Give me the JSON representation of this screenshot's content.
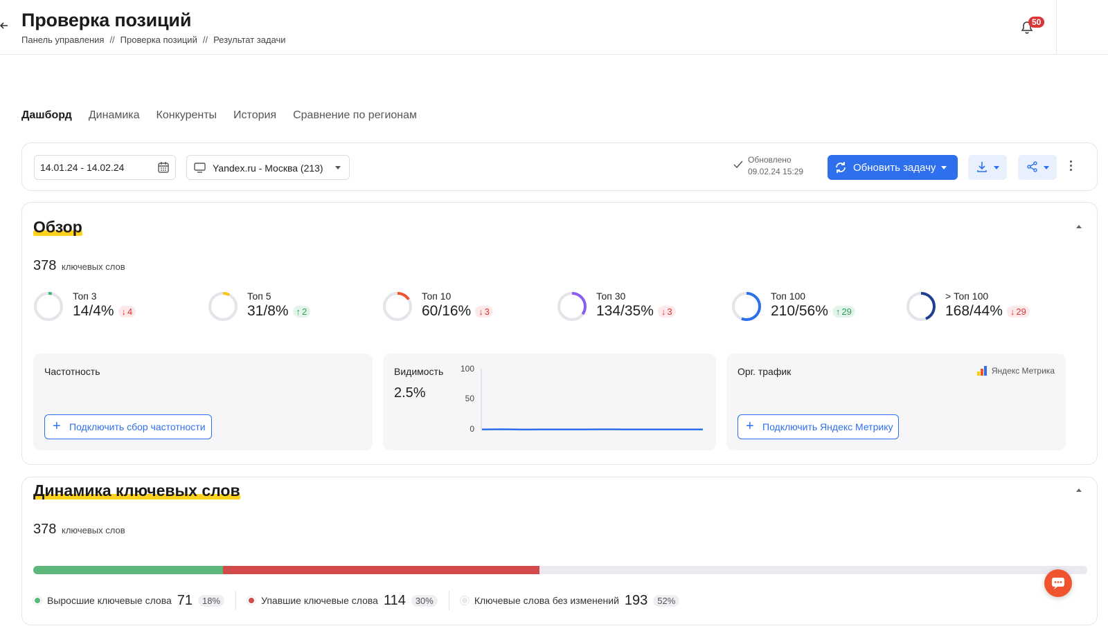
{
  "header": {
    "title": "Проверка позиций",
    "breadcrumb": [
      "Панель управления",
      "Проверка позиций",
      "Результат задачи"
    ],
    "breadcrumb_separator": "//",
    "notifications_count": "50"
  },
  "tabs": [
    {
      "label": "Дашборд",
      "active": true
    },
    {
      "label": "Динамика",
      "active": false
    },
    {
      "label": "Конкуренты",
      "active": false
    },
    {
      "label": "История",
      "active": false
    },
    {
      "label": "Сравнение по регионам",
      "active": false
    }
  ],
  "toolbar": {
    "date_range": "14.01.24 - 14.02.24",
    "region": "Yandex.ru - Москва (213)",
    "updated_label": "Обновлено",
    "updated_at": "09.02.24 15:29",
    "refresh_label": "Обновить задачу"
  },
  "overview": {
    "title": "Обзор",
    "keywords_count": "378",
    "keywords_label": "ключевых слов",
    "tops": [
      {
        "label": "Топ 3",
        "value": "14/4%",
        "percent": 4,
        "delta": "4",
        "direction": "down",
        "color": "#3cb371"
      },
      {
        "label": "Топ 5",
        "value": "31/8%",
        "percent": 8,
        "delta": "2",
        "direction": "up",
        "color": "#f5c518"
      },
      {
        "label": "Топ 10",
        "value": "60/16%",
        "percent": 16,
        "delta": "3",
        "direction": "down",
        "color": "#f0542e"
      },
      {
        "label": "Топ 30",
        "value": "134/35%",
        "percent": 35,
        "delta": "3",
        "direction": "down",
        "color": "#8a5cf0"
      },
      {
        "label": "Топ 100",
        "value": "210/56%",
        "percent": 56,
        "delta": "29",
        "direction": "up",
        "color": "#2d6fec"
      },
      {
        "label": "> Топ 100",
        "value": "168/44%",
        "percent": 44,
        "delta": "29",
        "direction": "down",
        "color": "#1e3f8f"
      }
    ],
    "frequency": {
      "title": "Частотность",
      "button": "Подключить сбор частотности"
    },
    "visibility": {
      "title": "Видимость",
      "value": "2.5%"
    },
    "organic": {
      "title": "Орг. трафик",
      "brand": "Яндекс Метрика",
      "button": "Подключить Яндекс Метрику"
    }
  },
  "chart_data": {
    "type": "line",
    "ylim": [
      0,
      100
    ],
    "y_ticks": [
      "100",
      "50",
      "0"
    ],
    "series": [
      {
        "values": [
          2.5,
          2.8,
          2.3,
          2.6,
          2.4,
          2.5,
          2.7,
          2.6,
          2.4,
          2.5,
          2.6,
          2.5
        ]
      }
    ]
  },
  "dynamics": {
    "title": "Динамика ключевых слов",
    "keywords_count": "378",
    "keywords_label": "ключевых слов",
    "legend": [
      {
        "label": "Выросшие ключевые слова",
        "count": "71",
        "pct": "18%",
        "share": 18,
        "color": "#5cb87a"
      },
      {
        "label": "Упавшие ключевые слова",
        "count": "114",
        "pct": "30%",
        "share": 30,
        "color": "#d24a4a"
      },
      {
        "label": "Ключевые слова без изменений",
        "count": "193",
        "pct": "52%",
        "share": 52,
        "color": "#e9e9ef"
      }
    ]
  }
}
